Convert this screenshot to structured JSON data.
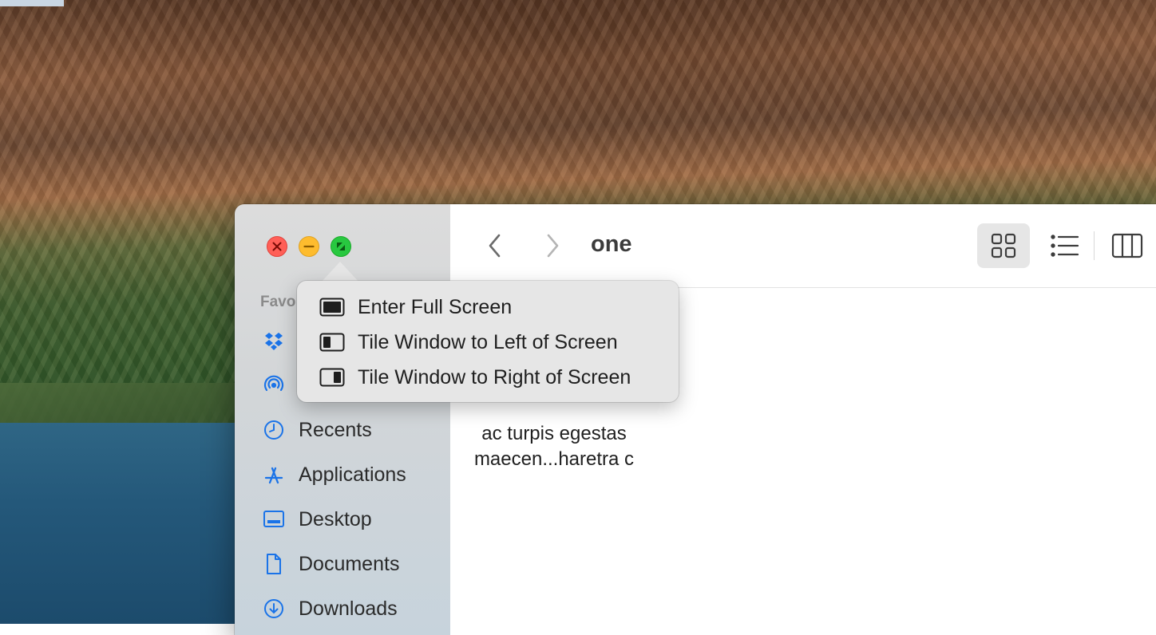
{
  "window": {
    "folder_title": "one",
    "traffic_lights": {
      "close": "close-icon",
      "minimize": "minimize-icon",
      "zoom": "zoom-icon"
    }
  },
  "sidebar": {
    "section_title": "Favo",
    "items": [
      {
        "icon": "dropbox-icon",
        "label": ""
      },
      {
        "icon": "airdrop-icon",
        "label": ""
      },
      {
        "icon": "clock-icon",
        "label": "Recents"
      },
      {
        "icon": "applications-icon",
        "label": "Applications"
      },
      {
        "icon": "desktop-icon",
        "label": "Desktop"
      },
      {
        "icon": "document-icon",
        "label": "Documents"
      },
      {
        "icon": "download-icon",
        "label": "Downloads"
      }
    ]
  },
  "toolbar": {
    "back": "chevron-left-icon",
    "forward": "chevron-right-icon",
    "views": [
      "grid-icon",
      "list-icon",
      "columns-icon"
    ]
  },
  "content": {
    "file_label_line1": "ac turpis egestas",
    "file_label_line2": "maecen...haretra c"
  },
  "zoom_menu": {
    "items": [
      {
        "icon": "fullscreen-icon",
        "label": "Enter Full Screen"
      },
      {
        "icon": "tile-left-icon",
        "label": "Tile Window to Left of Screen"
      },
      {
        "icon": "tile-right-icon",
        "label": "Tile Window to Right of Screen"
      }
    ]
  },
  "colors": {
    "close": "#ff5f57",
    "minimize": "#febc2e",
    "zoom": "#28c840",
    "accent": "#1a73e8"
  }
}
